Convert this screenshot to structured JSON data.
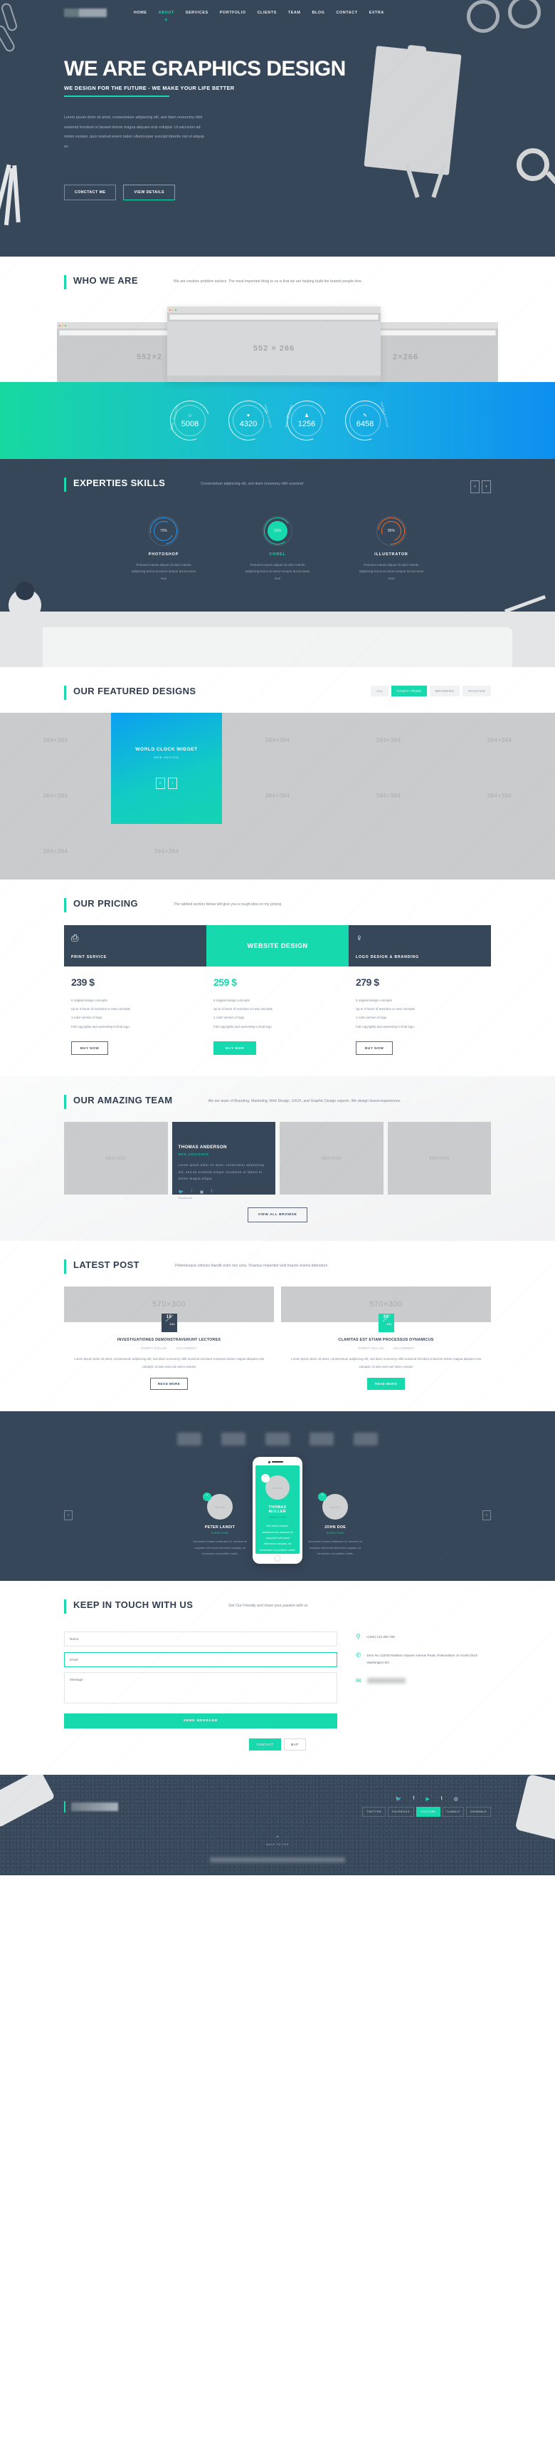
{
  "nav": {
    "logo_alt": "site-logo",
    "items": [
      {
        "label": "HOME",
        "active": false
      },
      {
        "label": "ABOUT",
        "active": true
      },
      {
        "label": "SERVICES",
        "active": false
      },
      {
        "label": "PORTFOLIO",
        "active": false
      },
      {
        "label": "CLIENTS",
        "active": false
      },
      {
        "label": "TEAM",
        "active": false
      },
      {
        "label": "BLOG",
        "active": false
      },
      {
        "label": "CONTACT",
        "active": false
      },
      {
        "label": "EXTRA",
        "active": false
      }
    ]
  },
  "hero": {
    "title": "WE ARE GRAPHICS DESIGN",
    "tagline": "WE DESIGN FOR THE FUTURE - WE MAKE YOUR LIFE BETTER",
    "paragraph": "Lorem ipsum dolor sit amet, consectetuer adipiscing elit, sed diam nonummy nibh euismod tincidunt ut laoreet dolore magna aliquam erat volutpat. Ut wisi enim ad minim veniam, quis nostrud exerci tation ullamcorper suscipit lobortis nisl ut aliquip ex",
    "btn_primary": "CONCTACT ME",
    "btn_secondary": "VIEW DETAILS"
  },
  "who_we_are": {
    "title": "WHO WE ARE",
    "subtitle": "We are creative problem solvers. The most important thing to us is that we are helping build the brands people love.",
    "browser_left": "552×2",
    "browser_center": "552 × 266",
    "browser_right": "2×266"
  },
  "counters": [
    {
      "value": "5008",
      "label": "TOTAL PROJECTS",
      "icon": "star-icon",
      "glyph": "☆"
    },
    {
      "value": "4320",
      "label": "HAPPY CLIENTS",
      "icon": "heart-icon",
      "glyph": "♥"
    },
    {
      "value": "1256",
      "label": "TEAM MEMBERS",
      "icon": "users-icon",
      "glyph": "♟"
    },
    {
      "value": "6458",
      "label": "HOURS WORKING",
      "icon": "pencil-icon",
      "glyph": "✎"
    }
  ],
  "skills": {
    "title": "EXPERTIES SKILLS",
    "subtitle": "Consectetuer adipiscing elit, sed diam nonummy nibh euismod",
    "prev": "‹",
    "next": "›",
    "items": [
      {
        "name": "PHOTOSHOP",
        "percent": "70%",
        "color": "#2196f3",
        "text": "Praesent mauris aliquet sit dolor interdu adipiscing lectus at rutrum tempor dui accusan mus"
      },
      {
        "name": "COREL",
        "percent": "50%",
        "color": "#16d9ad",
        "text": "Praesent mauris aliquet sit dolor interdu adipiscing lectus at rutrum tempor dui accusan mus"
      },
      {
        "name": "ILLUSTRATOR",
        "percent": "85%",
        "color": "#ef6723",
        "text": "Praesent mauris aliquet sit dolor interdu adipiscing lectus at rutrum tempor dui accusan mus"
      }
    ]
  },
  "portfolio": {
    "title": "OUR FEATURED DESIGNS",
    "filters": [
      {
        "label": "ALL",
        "active": false
      },
      {
        "label": "FANCY ITEMS",
        "active": true
      },
      {
        "label": "BRANDING",
        "active": false
      },
      {
        "label": "PACKAGE",
        "active": false
      }
    ],
    "placeholder": "384×384",
    "featured": {
      "title": "WORLD CLOCK WIDGET",
      "category": "WEB DESIGN",
      "zoom_icon": "⌕",
      "link_icon": "›"
    }
  },
  "pricing": {
    "title": "OUR PRICING",
    "subtitle": "The tabbed section below will give you a rough idea on my pricing",
    "plans": [
      {
        "name": "PRINT SERVICE",
        "icon": "printer-icon",
        "glyph": "⎙",
        "price": "239 $",
        "features": [
          "6 original design concepts",
          "Up to 3 hours of revisions or new concepts",
          "1-color version of logo",
          "Full copyrights and ownership to final logo"
        ],
        "cta": "BUY NOW",
        "highlight": false
      },
      {
        "name": "WEBSITE DESIGN",
        "icon": "rocket-icon",
        "glyph": "",
        "price": "259 $",
        "features": [
          "6 original design concepts",
          "Up to 3 hours of revisions or new concepts",
          "1-color version of logo",
          "Full copyrights and ownership to final logo"
        ],
        "cta": "BUY NOW",
        "highlight": true
      },
      {
        "name": "LOGO DESIGN & BRANDING",
        "icon": "bulb-icon",
        "glyph": "♀",
        "price": "279 $",
        "features": [
          "6 original design concepts",
          "Up to 3 hours of revisions or new concepts",
          "1-color version of logo",
          "Full copyrights and ownership to final logo"
        ],
        "cta": "BUY NOW",
        "highlight": false
      }
    ]
  },
  "team": {
    "title": "OUR AMAZING TEAM",
    "subtitle": "We are team of Branding, Marketing, Web Design, UI/UX, and Graphic Design experts. We design brand experiences.",
    "placeholder": "360×500",
    "active_member": {
      "name": "THOMAS ANDERSON",
      "role": "WEB DESIGNER",
      "bio": "Lorem ipsum dolor sit amet, consectetur adipisicing elit, sed do eiusmod tempor incididunt ut labore et dolore magna aliqua.",
      "socials": [
        {
          "name": "twitter-icon",
          "glyph": "🐦",
          "active": false
        },
        {
          "name": "facebook-icon",
          "glyph": "f",
          "active": true
        },
        {
          "name": "instagram-icon",
          "glyph": "▣",
          "active": false
        },
        {
          "name": "tumblr-icon",
          "glyph": "t",
          "active": false
        }
      ],
      "social_label": "Facebook"
    },
    "view_all": "VIEW ALL BROWSE"
  },
  "blog": {
    "title": "LATEST POST",
    "subtitle": "Pellentesque ultricies blandit enim nec urna. Vivamus imperdiet velit mauris viverra bibendum",
    "placeholder": "570×300",
    "posts": [
      {
        "day": "15",
        "month": "JUL",
        "title": "INVESTIGATIONES DEMONSTRAVERUNT LECTORES",
        "author": "ROBERT WILLIAM",
        "comments": "145 COMMENT",
        "excerpt": "Lorem ipsum dolor sit amet, consectetuer adipiscing elit, sed diam nonummy nibh euismod tincidunt ut laoreet dolore magna aliquam erat volutpat. Ut wisi enim ad minim veniam",
        "cta": "READ MORE",
        "highlight": false
      },
      {
        "day": "30",
        "month": "JUL",
        "title": "CLARITAS EST ETIAM PROCESSUS DYNAMICUS",
        "author": "ROBERT WILLIAM",
        "comments": "145 COMMENT",
        "excerpt": "Lorem ipsum dolor sit amet, consectetuer adipiscing elit, sed diam nonummy nibh euismod tincidunt ut laoreet dolore magna aliquam erat volutpat. Ut wisi enim ad minim veniam",
        "cta": "READ MORE",
        "highlight": true
      }
    ]
  },
  "testimonials": {
    "avatar_placeholder": "111×111",
    "quote_glyph": "“",
    "prev": "‹",
    "next": "›",
    "people": [
      {
        "name": "PETER LANDIT",
        "role": "DIRECTOR",
        "text": "Sed autem tempor vestibulum id, nesciunt mi voluptate velit esset bibendum voluptas, sit fermentum dui porttitor mattis",
        "active": false
      },
      {
        "name": "THOMAS MULLER",
        "role": "DIRECTOR",
        "text": "Sed autem tempor vestibulum id, nesciunt mi voluptate velit esset bibendum voluptas, sit fermentum dui porttitor mattis",
        "active": true
      },
      {
        "name": "JOHN DOE",
        "role": "DIRECTOR",
        "text": "Sed autem tempor vestibulum id, nesciunt mi voluptate velit esset bibendum voluptas, sit fermentum dui porttitor mattis",
        "active": false
      }
    ]
  },
  "contact": {
    "title": "KEEP IN TOUCH WITH US",
    "subtitle": "Get Our Friendly and share your passion with us",
    "name_placeholder": "Name",
    "email_placeholder": "Email",
    "message_placeholder": "Message",
    "send_label": "SEND MESSAGE",
    "phone": "+(400) 123 456 789",
    "address": "Door No 123/45 Madison Square Avenue Road, Palarivattam Jn South block Washington DC",
    "tabs": [
      {
        "label": "CONTACT",
        "active": true
      },
      {
        "label": "MAP",
        "active": false
      }
    ]
  },
  "footer": {
    "socials": [
      {
        "name": "twitter-icon",
        "glyph": "🐦",
        "label": "TWITTER",
        "active": false
      },
      {
        "name": "facebook-icon",
        "glyph": "f",
        "label": "FACEBOOK",
        "active": false
      },
      {
        "name": "youtube-icon",
        "glyph": "▶",
        "label": "YOUTUBE",
        "active": true
      },
      {
        "name": "tumblr-icon",
        "glyph": "t",
        "label": "TUMBLR",
        "active": false
      },
      {
        "name": "dribbble-icon",
        "glyph": "◎",
        "label": "DRIBBBLE",
        "active": false
      }
    ],
    "back_to_top": "BACK TO TOP",
    "arrow_glyph": "⌃"
  },
  "colors": {
    "accent": "#16d9ad",
    "dark": "#37475a",
    "blue": "#0e8ff0",
    "orange": "#ef6723"
  }
}
